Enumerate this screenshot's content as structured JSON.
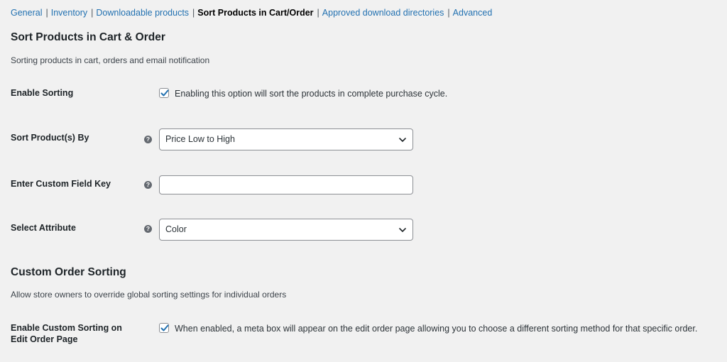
{
  "subnav": {
    "items": [
      {
        "label": "General"
      },
      {
        "label": "Inventory"
      },
      {
        "label": "Downloadable products"
      },
      {
        "label": "Sort Products in Cart/Order"
      },
      {
        "label": "Approved download directories"
      },
      {
        "label": "Advanced"
      }
    ],
    "separator": "|"
  },
  "section1": {
    "title": "Sort Products in Cart & Order",
    "description": "Sorting products in cart, orders and email notification"
  },
  "fields": {
    "enable_sorting": {
      "label": "Enable Sorting",
      "checked": true,
      "checkbox_text": "Enabling this option will sort the products in complete purchase cycle."
    },
    "sort_by": {
      "label": "Sort Product(s) By",
      "help": "?",
      "value": "Price Low to High"
    },
    "custom_field_key": {
      "label": "Enter Custom Field Key",
      "help": "?",
      "value": ""
    },
    "select_attribute": {
      "label": "Select Attribute",
      "help": "?",
      "value": "Color"
    },
    "enable_custom_sorting": {
      "label_line1": "Enable Custom Sorting on",
      "label_line2": "Edit Order Page",
      "checked": true,
      "checkbox_text": "When enabled, a meta box will appear on the edit order page allowing you to choose a different sorting method for that specific order."
    }
  },
  "section2": {
    "title": "Custom Order Sorting",
    "description": "Allow store owners to override global sorting settings for individual orders"
  },
  "colors": {
    "link": "#2271b1",
    "background": "#f1f1f1",
    "checkmark": "#2271b1"
  }
}
